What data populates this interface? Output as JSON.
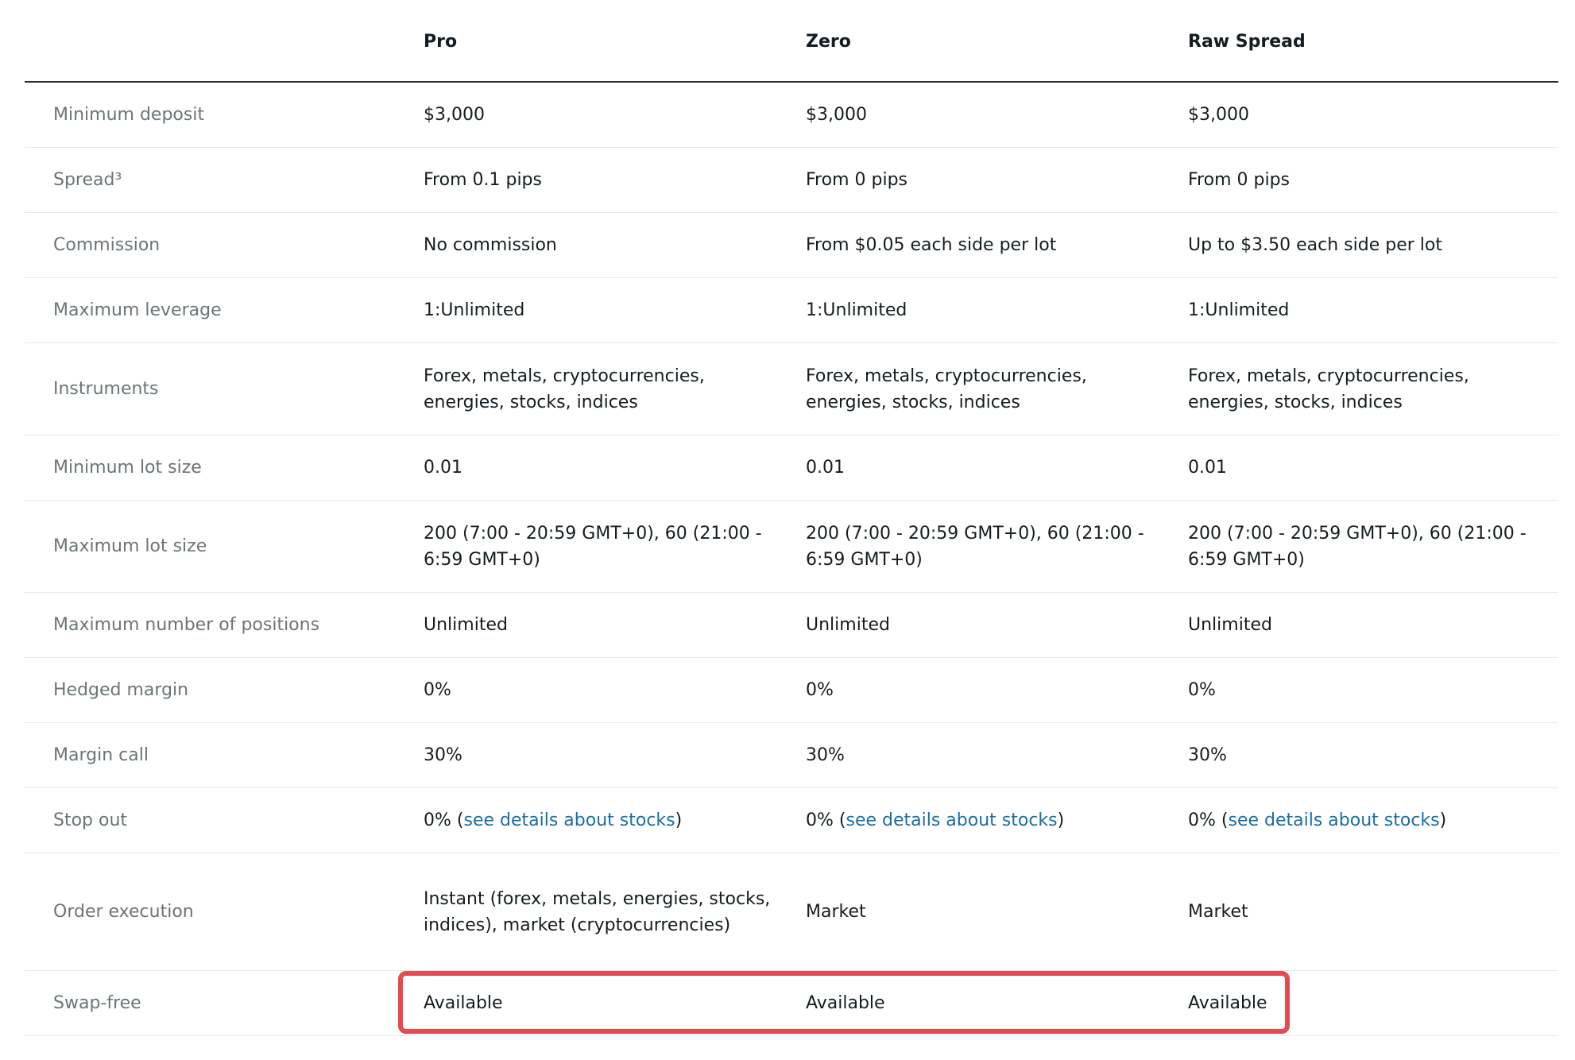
{
  "table": {
    "columns": [
      "",
      "Pro",
      "Zero",
      "Raw Spread"
    ],
    "rows": [
      {
        "label": "Minimum deposit",
        "pro": "$3,000",
        "zero": "$3,000",
        "raw": "$3,000"
      },
      {
        "label": "Spread³",
        "pro": "From 0.1 pips",
        "zero": "From 0 pips",
        "raw": "From 0 pips"
      },
      {
        "label": "Commission",
        "pro": "No commission",
        "zero": "From $0.05 each side per lot",
        "raw": "Up to $3.50 each side per lot"
      },
      {
        "label": "Maximum leverage",
        "pro": "1:Unlimited",
        "zero": "1:Unlimited",
        "raw": "1:Unlimited"
      },
      {
        "label": "Instruments",
        "pro": "Forex, metals, cryptocurrencies, energies, stocks, indices",
        "zero": "Forex, metals, cryptocurrencies, energies, stocks, indices",
        "raw": "Forex, metals, cryptocurrencies, energies, stocks, indices"
      },
      {
        "label": "Minimum lot size",
        "pro": "0.01",
        "zero": "0.01",
        "raw": "0.01"
      },
      {
        "label": "Maximum lot size",
        "pro": "200 (7:00 - 20:59 GMT+0), 60 (21:00 - 6:59 GMT+0)",
        "zero": "200 (7:00 - 20:59 GMT+0), 60 (21:00 - 6:59 GMT+0)",
        "raw": "200 (7:00 - 20:59 GMT+0), 60 (21:00 - 6:59 GMT+0)"
      },
      {
        "label": "Maximum number of positions",
        "pro": "Unlimited",
        "zero": "Unlimited",
        "raw": "Unlimited"
      },
      {
        "label": "Hedged margin",
        "pro": "0%",
        "zero": "0%",
        "raw": "0%"
      },
      {
        "label": "Margin call",
        "pro": "30%",
        "zero": "30%",
        "raw": "30%"
      },
      {
        "label": "Stop out",
        "pro_prefix": "0% (",
        "pro_link": "see details about stocks",
        "pro_suffix": ")",
        "zero_prefix": "0% (",
        "zero_link": "see details about stocks",
        "zero_suffix": ")",
        "raw_prefix": "0% (",
        "raw_link": "see details about stocks",
        "raw_suffix": ")"
      },
      {
        "label": "Order execution",
        "pro": "Instant (forex, metals, energies, stocks, indices), market (cryptocurrencies)",
        "zero": "Market",
        "raw": "Market"
      },
      {
        "label": "Swap-free",
        "pro": "Available",
        "zero": "Available",
        "raw": "Available"
      }
    ]
  },
  "colors": {
    "highlight": "#e54a4f",
    "link": "#1a6ea8",
    "label": "#6b7479",
    "text": "#141d22"
  }
}
